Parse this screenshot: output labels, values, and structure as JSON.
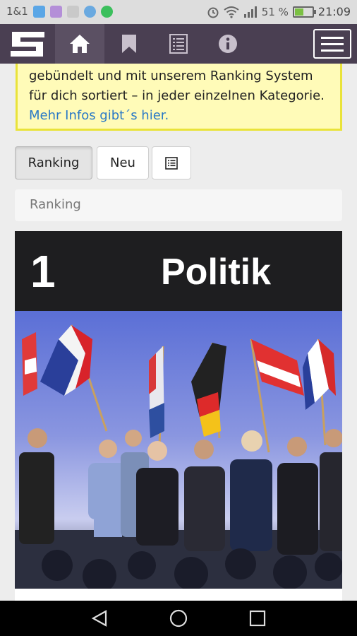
{
  "status_bar": {
    "carrier": "1&1",
    "battery_percent": "51 %",
    "battery_level": 0.51,
    "time": "21:09"
  },
  "navbar": {
    "items": [
      "home-icon",
      "bookmark-icon",
      "list-icon",
      "info-icon"
    ],
    "active_item": "home-icon",
    "colors": {
      "bar": "#4a3f52",
      "active": "#5b5063"
    }
  },
  "notice": {
    "line1": "gebündelt und mit unserem Ranking System",
    "line2": "für dich sortiert – in jeder einzelnen Kategorie.",
    "link": "Mehr Infos gibt´s hier."
  },
  "toolbar": {
    "ranking_label": "Ranking",
    "new_label": "Neu",
    "list_icon": "list-icon"
  },
  "breadcrumb": "Ranking",
  "card": {
    "rank": "1",
    "title": "Politik"
  }
}
